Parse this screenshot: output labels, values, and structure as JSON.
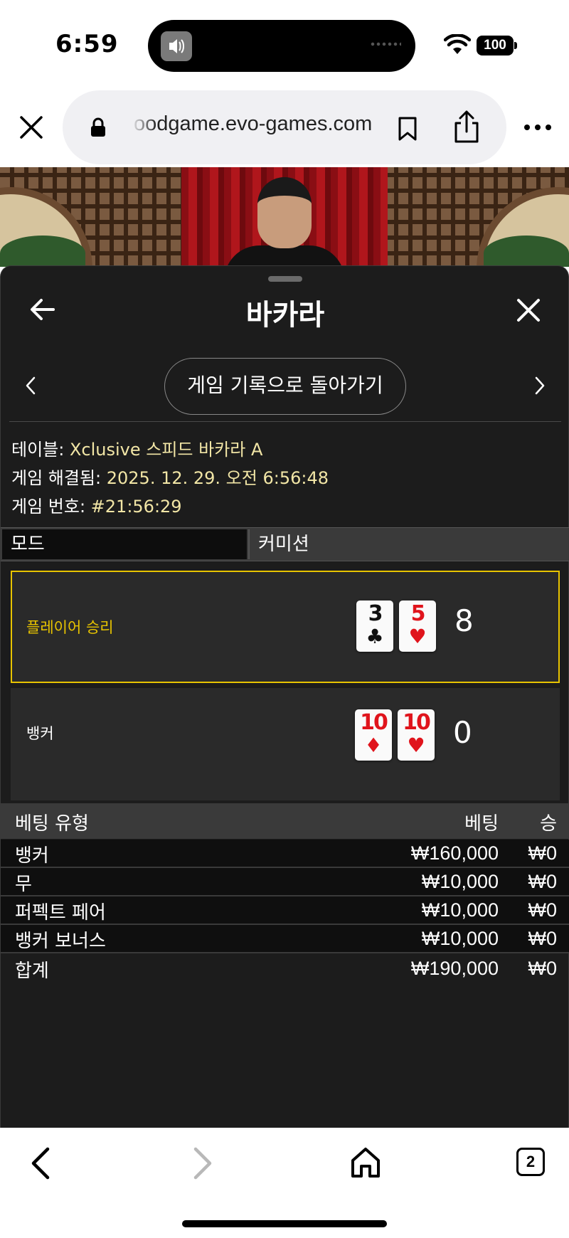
{
  "status_bar": {
    "time": "6:59",
    "battery": "100"
  },
  "browser": {
    "url": "oodgame.evo-games.com",
    "open_tabs": "2",
    "icons": [
      "close-icon",
      "lock-icon",
      "bookmark-icon",
      "share-icon",
      "more-icon",
      "back-icon",
      "forward-icon",
      "home-icon",
      "tabs-icon"
    ]
  },
  "sheet": {
    "title": "바카라",
    "history_button": "게임 기록으로 돌아가기",
    "info": {
      "table_label": "테이블: ",
      "table_value": "Xclusive 스피드 바카라 A",
      "resolved_label": "게임 해결됨: ",
      "resolved_value": "2025. 12. 29. 오전 6:56:48",
      "game_no_label": "게임 번호: ",
      "game_no_value": "#21:56:29"
    },
    "tabs": {
      "mode": "모드",
      "commission": "커미션"
    },
    "results": {
      "player": {
        "label": "플레이어 승리",
        "cards": [
          {
            "rank": "3",
            "suit": "♣",
            "color": "black"
          },
          {
            "rank": "5",
            "suit": "♥",
            "color": "red"
          }
        ],
        "score": "8"
      },
      "banker": {
        "label": "뱅커",
        "cards": [
          {
            "rank": "10",
            "suit": "♦",
            "color": "red"
          },
          {
            "rank": "10",
            "suit": "♥",
            "color": "red"
          }
        ],
        "score": "0"
      }
    },
    "bets": {
      "headers": {
        "type": "베팅 유형",
        "bet": "베팅",
        "win": "승"
      },
      "rows": [
        {
          "type": "뱅커",
          "bet": "₩160,000",
          "win": "₩0"
        },
        {
          "type": "무",
          "bet": "₩10,000",
          "win": "₩0"
        },
        {
          "type": "퍼펙트 페어",
          "bet": "₩10,000",
          "win": "₩0"
        },
        {
          "type": "뱅커 보너스",
          "bet": "₩10,000",
          "win": "₩0"
        }
      ],
      "total": {
        "type": "합계",
        "bet": "₩190,000",
        "win": "₩0"
      }
    }
  },
  "colors": {
    "sheet_bg": "#1c1c1c",
    "highlight": "#e8c400",
    "info_value": "#f2e6a6",
    "card_red": "#e0141c"
  }
}
